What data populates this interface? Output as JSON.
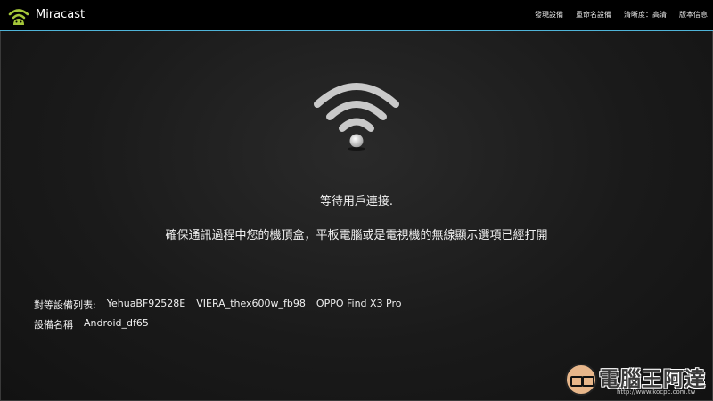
{
  "app": {
    "title": "Miracast",
    "icon": "wifi-android-icon",
    "accent_color": "#4fb4d8"
  },
  "menu": {
    "items": [
      "發現設備",
      "重命名設備",
      "清晰度：高清",
      "版本信息"
    ]
  },
  "main": {
    "icon": "wifi-signal-icon",
    "status": "等待用戶連接.",
    "instruction": "確保通訊過程中您的機頂盒，平板電腦或是電視機的無線顯示選項已經打開"
  },
  "devices": {
    "label": "對等設備列表:",
    "items": [
      "YehuaBF92528E",
      "VIERA_thex600w_fb98",
      "OPPO Find X3 Pro"
    ]
  },
  "device_name": {
    "label": "設備名稱",
    "value": "Android_df65"
  },
  "watermark": {
    "text": "電腦王阿達",
    "url": "http://www.kocpc.com.tw"
  }
}
